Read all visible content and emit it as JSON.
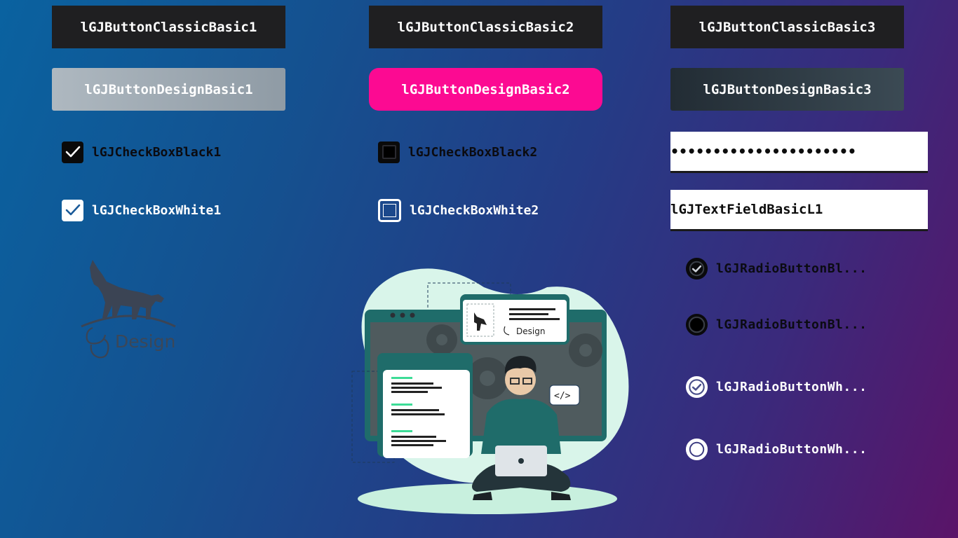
{
  "buttons_classic": [
    {
      "label": "lGJButtonClassicBasic1"
    },
    {
      "label": "lGJButtonClassicBasic2"
    },
    {
      "label": "lGJButtonClassicBasic3"
    }
  ],
  "buttons_design": [
    {
      "label": "lGJButtonDesignBasic1"
    },
    {
      "label": "lGJButtonDesignBasic2"
    },
    {
      "label": "lGJButtonDesignBasic3"
    }
  ],
  "checkboxes": [
    {
      "label": "lGJCheckBoxBlack1",
      "checked": true
    },
    {
      "label": "lGJCheckBoxBlack2",
      "checked": false
    },
    {
      "label": "lGJCheckBoxWhite1",
      "checked": true
    },
    {
      "label": "lGJCheckBoxWhite2",
      "checked": false
    }
  ],
  "password_field": {
    "value": "••••••••••••••••••••••"
  },
  "text_field": {
    "value": "lGJTextFieldBasicL1"
  },
  "radios": [
    {
      "label": "lGJRadioButtonBl...",
      "selected": true
    },
    {
      "label": "lGJRadioButtonBl...",
      "selected": false
    },
    {
      "label": "lGJRadioButtonWh...",
      "selected": true
    },
    {
      "label": "lGJRadioButtonWh...",
      "selected": false
    }
  ],
  "logo": {
    "text": "Design",
    "icon": "wolf-icon"
  },
  "illustration": {
    "card_logo_text": "Design",
    "code_tag": "</>"
  },
  "colors": {
    "classic_button": "#1f1f21",
    "design_pink": "#fc0a92",
    "background_start": "#0a62a0",
    "background_end": "#5a1468"
  }
}
